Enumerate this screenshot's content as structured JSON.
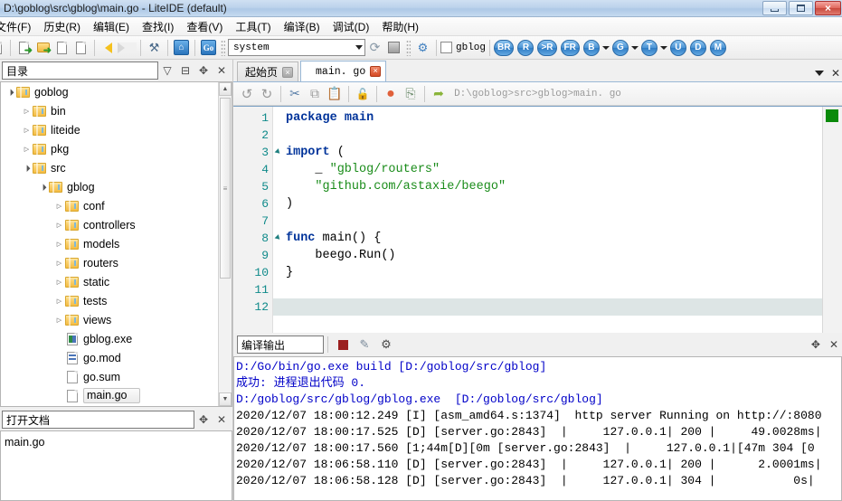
{
  "window": {
    "title": "D:\\goblog\\src\\gblog\\main.go - LiteIDE (default)",
    "minimize_label": "",
    "maximize_label": "",
    "close_label": "×"
  },
  "menubar": {
    "items": [
      {
        "label": "文件(F)",
        "name": "menu-file"
      },
      {
        "label": "历史(R)",
        "name": "menu-history"
      },
      {
        "label": "编辑(E)",
        "name": "menu-edit"
      },
      {
        "label": "查找(I)",
        "name": "menu-find"
      },
      {
        "label": "查看(V)",
        "name": "menu-view"
      },
      {
        "label": "工具(T)",
        "name": "menu-tools"
      },
      {
        "label": "编译(B)",
        "name": "menu-build"
      },
      {
        "label": "调试(D)",
        "name": "menu-debug"
      },
      {
        "label": "帮助(H)",
        "name": "menu-help"
      }
    ]
  },
  "toolbar": {
    "env_combo_value": "system",
    "project_checkbox_label": "gblog",
    "build_buttons": [
      {
        "label": "BR",
        "name": "toolbar-build-run-button",
        "caret": false
      },
      {
        "label": "R",
        "name": "toolbar-run-button",
        "caret": false
      },
      {
        "label": ">R",
        "name": "toolbar-run-file-button",
        "caret": false
      },
      {
        "label": "FR",
        "name": "toolbar-file-run-button",
        "caret": false
      },
      {
        "label": "B",
        "name": "toolbar-build-button",
        "caret": true
      },
      {
        "label": "G",
        "name": "toolbar-goget-button",
        "caret": true
      },
      {
        "label": "T",
        "name": "toolbar-test-button",
        "caret": true
      },
      {
        "label": "U",
        "name": "toolbar-update-button",
        "caret": false
      },
      {
        "label": "D",
        "name": "toolbar-doc-button",
        "caret": false
      },
      {
        "label": "M",
        "name": "toolbar-make-button",
        "caret": false
      }
    ]
  },
  "sidebar": {
    "combo_value": "目录",
    "head_icons": [
      "filter-icon",
      "collapse-icon",
      "locate-icon",
      "close-icon"
    ],
    "tree": [
      {
        "label": "goblog",
        "indent": 0,
        "twist": "down",
        "icon": "folder",
        "selected": false
      },
      {
        "label": "bin",
        "indent": 1,
        "twist": "right",
        "icon": "folder",
        "selected": false
      },
      {
        "label": "liteide",
        "indent": 1,
        "twist": "right",
        "icon": "folder",
        "selected": false
      },
      {
        "label": "pkg",
        "indent": 1,
        "twist": "right",
        "icon": "folder",
        "selected": false
      },
      {
        "label": "src",
        "indent": 1,
        "twist": "down",
        "icon": "folder",
        "selected": false
      },
      {
        "label": "gblog",
        "indent": 2,
        "twist": "down",
        "icon": "folder",
        "selected": false
      },
      {
        "label": "conf",
        "indent": 3,
        "twist": "right",
        "icon": "folder",
        "selected": false
      },
      {
        "label": "controllers",
        "indent": 3,
        "twist": "right",
        "icon": "folder",
        "selected": false
      },
      {
        "label": "models",
        "indent": 3,
        "twist": "right",
        "icon": "folder",
        "selected": false
      },
      {
        "label": "routers",
        "indent": 3,
        "twist": "right",
        "icon": "folder",
        "selected": false
      },
      {
        "label": "static",
        "indent": 3,
        "twist": "right",
        "icon": "folder",
        "selected": false
      },
      {
        "label": "tests",
        "indent": 3,
        "twist": "right",
        "icon": "folder",
        "selected": false
      },
      {
        "label": "views",
        "indent": 3,
        "twist": "right",
        "icon": "folder",
        "selected": false
      },
      {
        "label": "gblog.exe",
        "indent": 3,
        "twist": "",
        "icon": "exe",
        "selected": false
      },
      {
        "label": "go.mod",
        "indent": 3,
        "twist": "",
        "icon": "mod",
        "selected": false
      },
      {
        "label": "go.sum",
        "indent": 3,
        "twist": "",
        "icon": "file",
        "selected": false
      },
      {
        "label": "main.go",
        "indent": 3,
        "twist": "",
        "icon": "file",
        "selected": true
      }
    ]
  },
  "docpanel": {
    "combo_value": "打开文档",
    "items": [
      {
        "label": "main.go"
      }
    ]
  },
  "editor": {
    "tabs": [
      {
        "label": "起始页",
        "active": false,
        "close": "×"
      },
      {
        "label": "main. go",
        "active": true,
        "close": "×"
      }
    ],
    "path": "D:\\goblog>src>gblog>main. go",
    "lines": [
      {
        "n": "1",
        "fold": false,
        "current": false,
        "tokens": [
          {
            "t": "package ",
            "c": "kw"
          },
          {
            "t": "main",
            "c": "kw"
          }
        ]
      },
      {
        "n": "2",
        "fold": false,
        "current": false,
        "tokens": []
      },
      {
        "n": "3",
        "fold": true,
        "current": false,
        "tokens": [
          {
            "t": "import",
            "c": "kw"
          },
          {
            "t": " (",
            "c": ""
          }
        ]
      },
      {
        "n": "4",
        "fold": false,
        "current": false,
        "tokens": [
          {
            "t": "    _ ",
            "c": ""
          },
          {
            "t": "\"gblog/routers\"",
            "c": "str"
          }
        ]
      },
      {
        "n": "5",
        "fold": false,
        "current": false,
        "tokens": [
          {
            "t": "    ",
            "c": ""
          },
          {
            "t": "\"github.com/astaxie/beego\"",
            "c": "str"
          }
        ]
      },
      {
        "n": "6",
        "fold": false,
        "current": false,
        "tokens": [
          {
            "t": ")",
            "c": ""
          }
        ]
      },
      {
        "n": "7",
        "fold": false,
        "current": false,
        "tokens": []
      },
      {
        "n": "8",
        "fold": true,
        "current": false,
        "tokens": [
          {
            "t": "func",
            "c": "kw"
          },
          {
            "t": " main() {",
            "c": ""
          }
        ]
      },
      {
        "n": "9",
        "fold": false,
        "current": false,
        "tokens": [
          {
            "t": "    beego.Run()",
            "c": ""
          }
        ]
      },
      {
        "n": "10",
        "fold": false,
        "current": false,
        "tokens": [
          {
            "t": "}",
            "c": ""
          }
        ]
      },
      {
        "n": "11",
        "fold": false,
        "current": false,
        "tokens": []
      },
      {
        "n": "12",
        "fold": false,
        "current": true,
        "tokens": []
      }
    ]
  },
  "output": {
    "combo_value": "编译输出",
    "lines": [
      {
        "text": "D:/Go/bin/go.exe build [D:/goblog/src/gblog]",
        "color": "blue"
      },
      {
        "text": "成功: 进程退出代码 0.",
        "color": "blue"
      },
      {
        "text": "D:/goblog/src/gblog/gblog.exe  [D:/goblog/src/gblog]",
        "color": "blue"
      },
      {
        "text": "2020/12/07 18:00:12.249 [I] [asm_amd64.s:1374]  http server Running on http://:8080",
        "color": "black"
      },
      {
        "text": "2020/12/07 18:00:17.525 [D] [server.go:2843]  |     127.0.0.1| 200 |     49.0028ms|",
        "color": "black"
      },
      {
        "text": "2020/12/07 18:00:17.560 [1;44m[D][0m [server.go:2843]  |     127.0.0.1|[47m 304 [0",
        "color": "black"
      },
      {
        "text": "2020/12/07 18:06:58.110 [D] [server.go:2843]  |     127.0.0.1| 200 |      2.0001ms|",
        "color": "black"
      },
      {
        "text": "2020/12/07 18:06:58.128 [D] [server.go:2843]  |     127.0.0.1| 304 |           0s|",
        "color": "black"
      }
    ]
  },
  "colors": {
    "keyword": "#00339a",
    "string": "#1a8c1a",
    "linenumber": "#0f8a8a",
    "console_blue": "#0000c8",
    "accent_blue": "#2a74bc",
    "marker_green": "#0a8a0a"
  }
}
